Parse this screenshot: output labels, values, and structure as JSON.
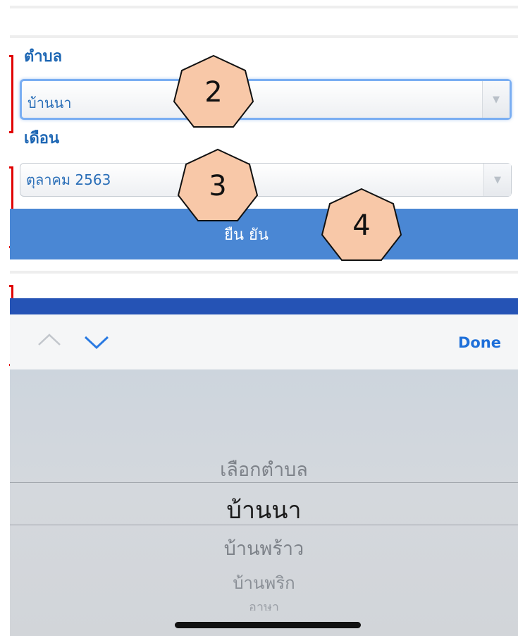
{
  "form": {
    "subdistrict_label": "ตำบล",
    "subdistrict_value": "บ้านนา",
    "month_label": "เดือน",
    "month_value": "ตุลาคม 2563",
    "confirm_label": "ยืน ยัน"
  },
  "callouts": [
    "2",
    "3",
    "4"
  ],
  "keyboard_toolbar": {
    "done_label": "Done"
  },
  "picker": {
    "options": [
      "เลือกตำบล",
      "บ้านนา",
      "บ้านพร้าว",
      "บ้านพริก",
      "อาษา"
    ],
    "selected_index": 1
  },
  "colors": {
    "accent": "#1e67b4",
    "confirm_button": "#4a87d4",
    "blue_band": "#2553b5",
    "callout_fill": "#f8c8a8",
    "bracket": "#e10000"
  }
}
